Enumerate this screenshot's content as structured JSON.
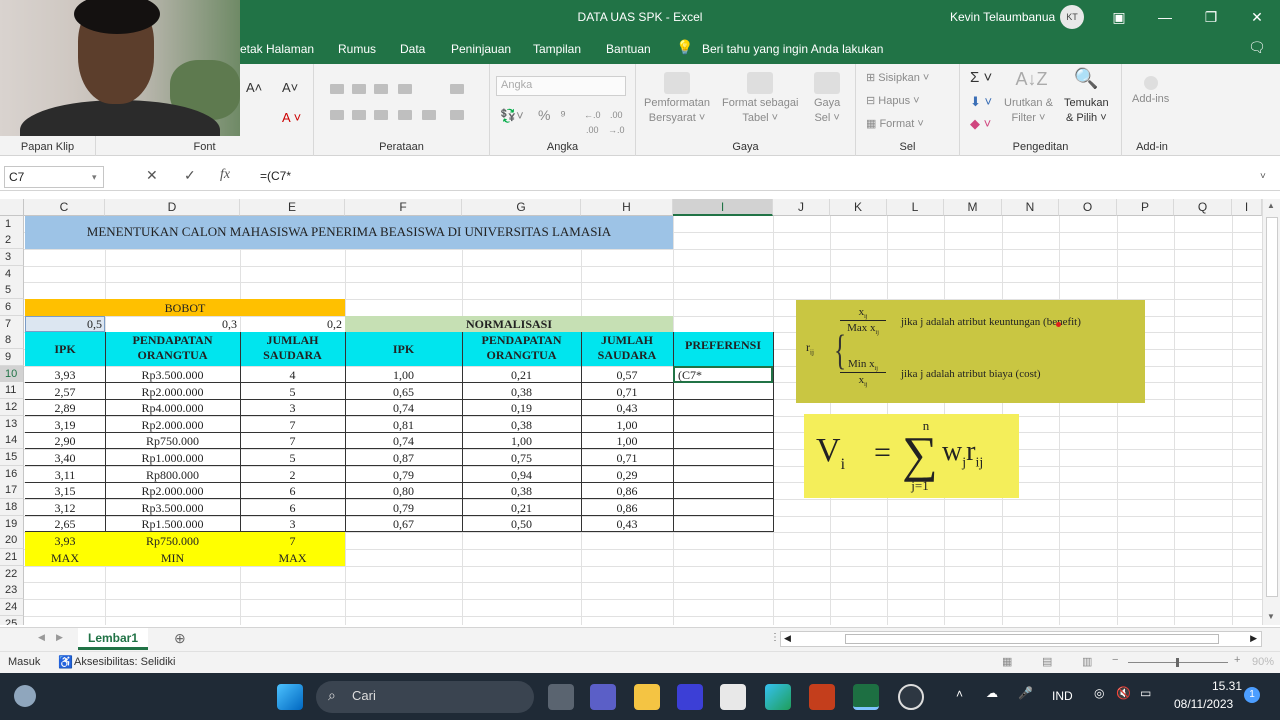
{
  "window": {
    "title": "DATA UAS SPK  -  Excel",
    "user": "Kevin Telaumbanua",
    "user_initials": "KT"
  },
  "menu": [
    "etak Halaman",
    "Rumus",
    "Data",
    "Peninjauan",
    "Tampilan",
    "Bantuan"
  ],
  "tell_me": "Beri tahu yang ingin Anda lakukan",
  "ribbon": {
    "groups": [
      "Papan Klip",
      "Font",
      "Perataan",
      "Angka",
      "Gaya",
      "Sel",
      "Pengeditan",
      "Add-in"
    ],
    "number_format": "Angka",
    "cond_format": [
      "Pemformatan",
      "Bersyarat"
    ],
    "format_table": [
      "Format sebagai",
      "Tabel"
    ],
    "cell_style": [
      "Gaya",
      "Sel"
    ],
    "insert": "Sisipkan",
    "delete": "Hapus",
    "format": "Format",
    "sort": [
      "Urutkan &",
      "Filter"
    ],
    "find": [
      "Temukan",
      "& Pilih"
    ],
    "addins": "Add-ins"
  },
  "formula_bar": {
    "name_box": "C7",
    "formula": "=(C7*"
  },
  "columns": [
    "C",
    "D",
    "E",
    "F",
    "G",
    "H",
    "I",
    "J",
    "K",
    "L",
    "M",
    "N",
    "O",
    "P",
    "Q",
    "I"
  ],
  "rows": [
    "1",
    "2",
    "3",
    "4",
    "5",
    "6",
    "7",
    "8",
    "9",
    "10",
    "11",
    "12",
    "13",
    "14",
    "15",
    "16",
    "17",
    "18",
    "19",
    "20",
    "21",
    "22",
    "23",
    "24",
    "25"
  ],
  "sheet": {
    "title": "MENENTUKAN CALON MAHASISWA PENERIMA BEASISWA DI UNIVERSITAS LAMASIA",
    "bobot_label": "BOBOT",
    "weights": [
      "0,5",
      "0,3",
      "0,2"
    ],
    "normalisasi_label": "NORMALISASI",
    "preferensi_label": "PREFERENSI",
    "headers": [
      "IPK",
      "PENDAPATAN ORANGTUA",
      "JUMLAH SAUDARA"
    ],
    "header_lines": {
      "pend1": "PENDAPATAN",
      "pend2": "ORANGTUA",
      "jml1": "JUMLAH",
      "jml2": "SAUDARA"
    },
    "data": [
      [
        "3,93",
        "Rp3.500.000",
        "4",
        "1,00",
        "0,21",
        "0,57"
      ],
      [
        "2,57",
        "Rp2.000.000",
        "5",
        "0,65",
        "0,38",
        "0,71"
      ],
      [
        "2,89",
        "Rp4.000.000",
        "3",
        "0,74",
        "0,19",
        "0,43"
      ],
      [
        "3,19",
        "Rp2.000.000",
        "7",
        "0,81",
        "0,38",
        "1,00"
      ],
      [
        "2,90",
        "Rp750.000",
        "7",
        "0,74",
        "1,00",
        "1,00"
      ],
      [
        "3,40",
        "Rp1.000.000",
        "5",
        "0,87",
        "0,75",
        "0,71"
      ],
      [
        "3,11",
        "Rp800.000",
        "2",
        "0,79",
        "0,94",
        "0,29"
      ],
      [
        "3,15",
        "Rp2.000.000",
        "6",
        "0,80",
        "0,38",
        "0,86"
      ],
      [
        "3,12",
        "Rp3.500.000",
        "6",
        "0,79",
        "0,21",
        "0,86"
      ],
      [
        "2,65",
        "Rp1.500.000",
        "3",
        "0,67",
        "0,50",
        "0,43"
      ]
    ],
    "extremes": [
      "3,93",
      "Rp750.000",
      "7"
    ],
    "criteria": [
      "MAX",
      "MIN",
      "MAX"
    ],
    "editing_cell": "(C7*"
  },
  "formula_image": {
    "rij": "r",
    "rij_sub": "ij",
    "benefit_num": "x",
    "benefit_den": "Max x",
    "benefit_text": "jika j adalah atribut keuntungan (benefit)",
    "cost_num": "Min x",
    "cost_den": "x",
    "cost_text": "jika j adalah atribut biaya (cost)",
    "vi_lhs": "V",
    "vi_sub": "i",
    "sum_top": "n",
    "sum_bottom": "j=1",
    "rhs": "w",
    "rhs_sub1": "j",
    "rhs_r": "r",
    "rhs_sub2": "ij"
  },
  "sheet_tab": "Lembar1",
  "status": {
    "mode": "Masuk",
    "accessibility": "Aksesibilitas: Selidiki",
    "zoom": "90%"
  },
  "taskbar": {
    "search": "Cari",
    "lang": "IND",
    "time": "15.31",
    "date": "08/11/2023",
    "notif": "1"
  }
}
